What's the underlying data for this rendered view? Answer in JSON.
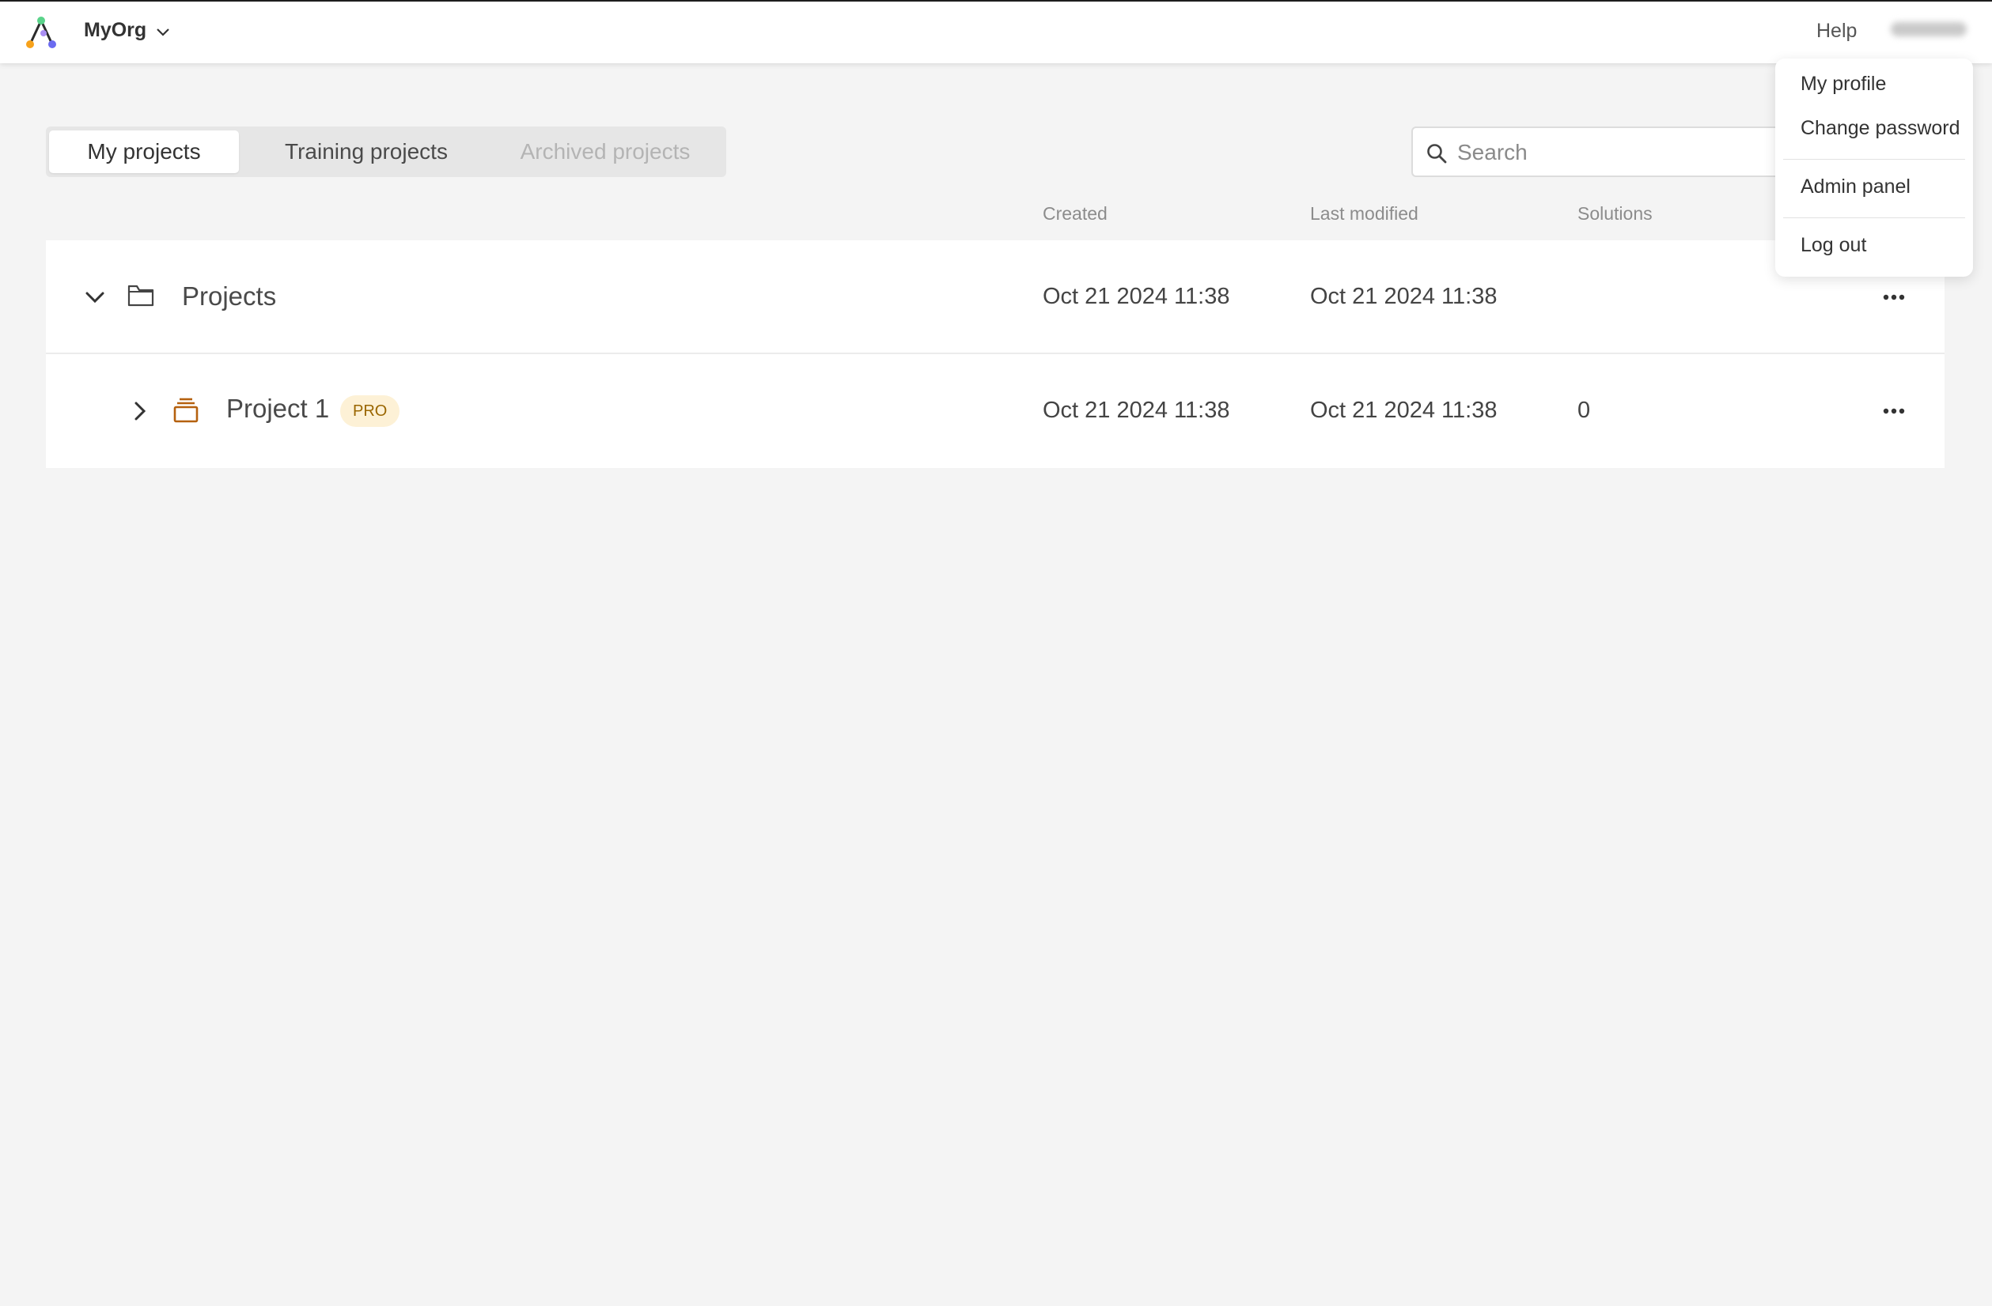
{
  "header": {
    "org_name": "MyOrg",
    "help_label": "Help"
  },
  "tabs": [
    {
      "label": "My projects",
      "active": true
    },
    {
      "label": "Training projects",
      "active": false
    },
    {
      "label": "Archived projects",
      "active": false,
      "disabled": true
    }
  ],
  "search": {
    "placeholder": "Search",
    "value": ""
  },
  "columns": {
    "created": "Created",
    "last_modified": "Last modified",
    "solutions": "Solutions"
  },
  "rows": [
    {
      "name": "Projects",
      "type": "folder",
      "expanded": true,
      "created": "Oct 21 2024 11:38",
      "last_modified": "Oct 21 2024 11:38",
      "solutions": ""
    },
    {
      "name": "Project 1",
      "type": "project",
      "expanded": false,
      "badge": "PRO",
      "created": "Oct 21 2024 11:38",
      "last_modified": "Oct 21 2024 11:38",
      "solutions": "0"
    }
  ],
  "user_menu": {
    "items": [
      "My profile",
      "Change password",
      "Admin panel",
      "Log out"
    ]
  },
  "colors": {
    "background": "#f4f4f4",
    "surface": "#ffffff",
    "project_icon": "#b5610f",
    "badge_bg": "#fdf1d6",
    "badge_text": "#9a6600"
  },
  "icons": {
    "logo": "app-logo",
    "org_switch": "chevron-down-icon",
    "search": "search-icon",
    "row1_toggle": "chevron-down-icon",
    "row1_type": "folder-icon",
    "row2_toggle": "chevron-right-icon",
    "row2_type": "stack-icon",
    "row_actions": "more-horizontal-icon"
  }
}
